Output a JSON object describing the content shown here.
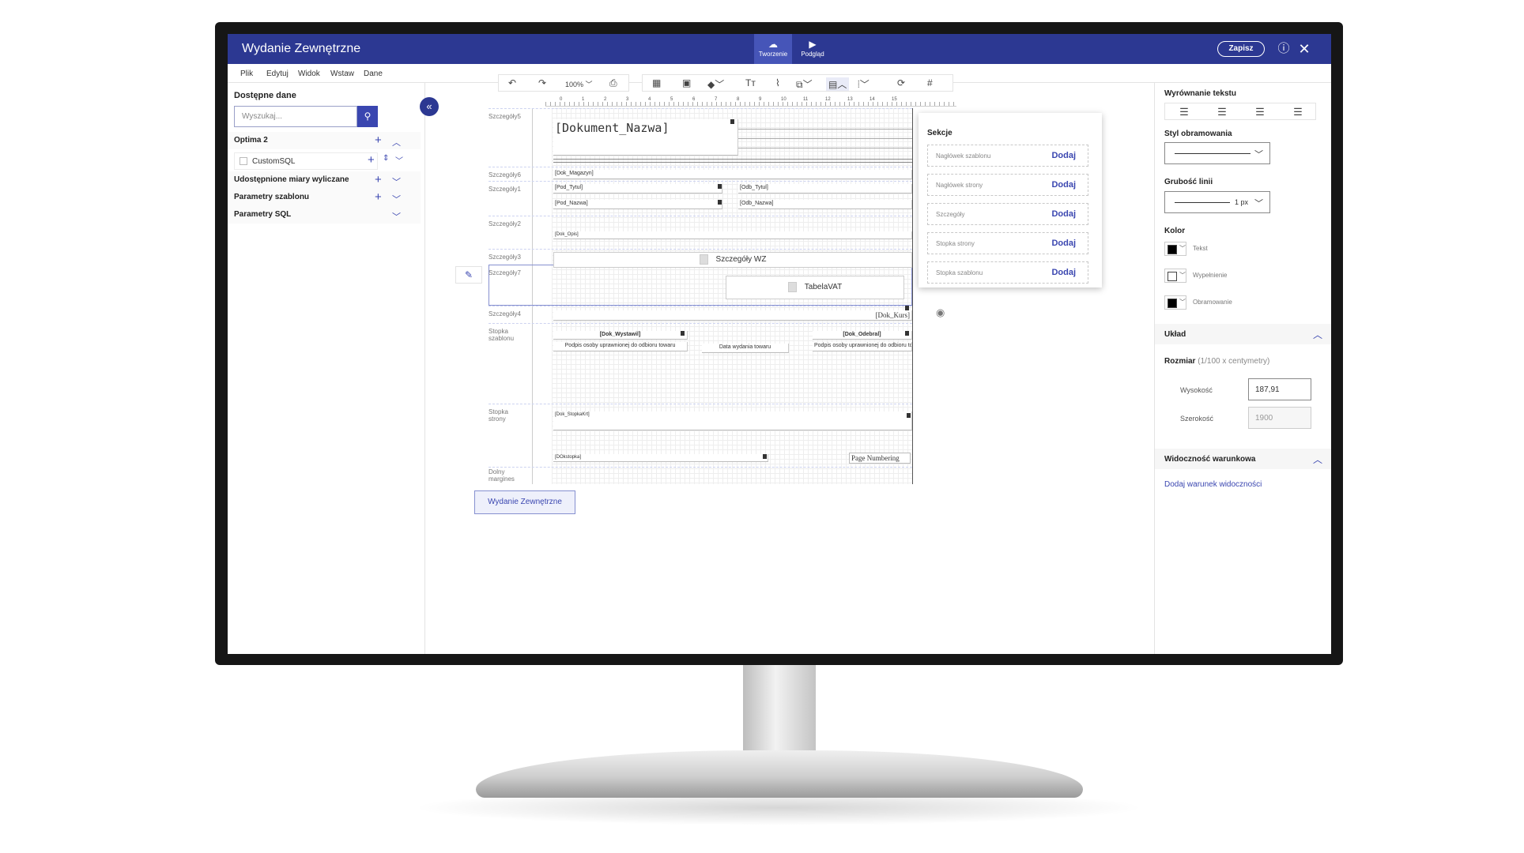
{
  "app": {
    "title": "Wydanie Zewnętrzne",
    "save_label": "Zapisz",
    "help_icon": "help-icon",
    "close_icon": "close-icon"
  },
  "modes": [
    {
      "label": "Tworzenie",
      "icon": "design-icon"
    },
    {
      "label": "Podgląd",
      "icon": "play-icon"
    }
  ],
  "menu": [
    "Plik",
    "Edytuj",
    "Widok",
    "Wstaw",
    "Dane"
  ],
  "left_panel": {
    "title": "Dostępne dane",
    "search_placeholder": "Wyszukaj...",
    "groups": [
      "Optima 2",
      "Udostępnione miary wyliczane",
      "Parametry szablonu",
      "Parametry SQL"
    ],
    "sub_item": "CustomSQL"
  },
  "toolbar": {
    "zoom": "100%"
  },
  "canvas": {
    "sections": [
      "Szczegóły5",
      "Szczegóły6",
      "Szczegóły1",
      "Szczegóły2",
      "Szczegóły3",
      "Szczegóły7",
      "Szczegóły4",
      "Stopka szablonu",
      "Stopka strony",
      "Dolny margines"
    ],
    "fields": {
      "dok_nazwa": "[Dokument_Nazwa]",
      "dok_magazyn": "[Dok_Magazyn]",
      "pod_tytul": "[Pod_Tytul]",
      "pod_nazwa": "[Pod_Nazwa]",
      "odb_tytul": "[Odb_Tytul]",
      "odb_nazwa": "[Odb_Nazwa]",
      "dok_opis": "[Dok_Opis]",
      "szczegoly_wz": "Szczegóły WZ",
      "tabela_vat": "TabelaVAT",
      "dok_kurs": "[Dok_Kurs]",
      "dok_wystawil": "[Dok_Wystawil]",
      "podpis1": "Podpis osoby uprawnionej do odbioru towaru",
      "data_wydania": "Data wydania towaru",
      "dok_odebral": "[Dok_Odebral]",
      "podpis2": "Podpis osoby uprawnionej do odbioru towaru",
      "dok_stopkakrt": "[Dok_StopkaKrt]",
      "dokstopka": "[DOkstopka]",
      "page_numbering": "Page Numbering"
    },
    "ruler": [
      "0",
      "1",
      "2",
      "3",
      "4",
      "5",
      "6",
      "7",
      "8",
      "9",
      "10",
      "11",
      "12",
      "13",
      "14",
      "15"
    ],
    "page_tab": "Wydanie Zewnętrzne"
  },
  "sections_popup": {
    "title": "Sekcje",
    "items": [
      "Nagłówek szablonu",
      "Nagłówek strony",
      "Szczegóły",
      "Stopka strony",
      "Stopka szablonu"
    ],
    "add_label": "Dodaj"
  },
  "right_panel": {
    "text_align": "Wyrównanie tekstu",
    "border_style": "Styl obramowania",
    "line_width": "Grubość linii",
    "line_width_value": "1 px",
    "color": "Kolor",
    "colors": [
      {
        "label": "Tekst",
        "value": "#000000"
      },
      {
        "label": "Wypełnienie",
        "value": "#ffffff"
      },
      {
        "label": "Obramowanie",
        "value": "#000000"
      }
    ],
    "layout": "Układ",
    "size_label": "Rozmiar",
    "size_unit": "(1/100 x centymetry)",
    "height_label": "Wysokość",
    "height_value": "187,91",
    "width_label": "Szerokość",
    "width_value": "1900",
    "visibility": "Widoczność warunkowa",
    "add_visibility": "Dodaj warunek widoczności"
  },
  "colors": {
    "brand": "#2c3892",
    "accent": "#3a46b0"
  }
}
